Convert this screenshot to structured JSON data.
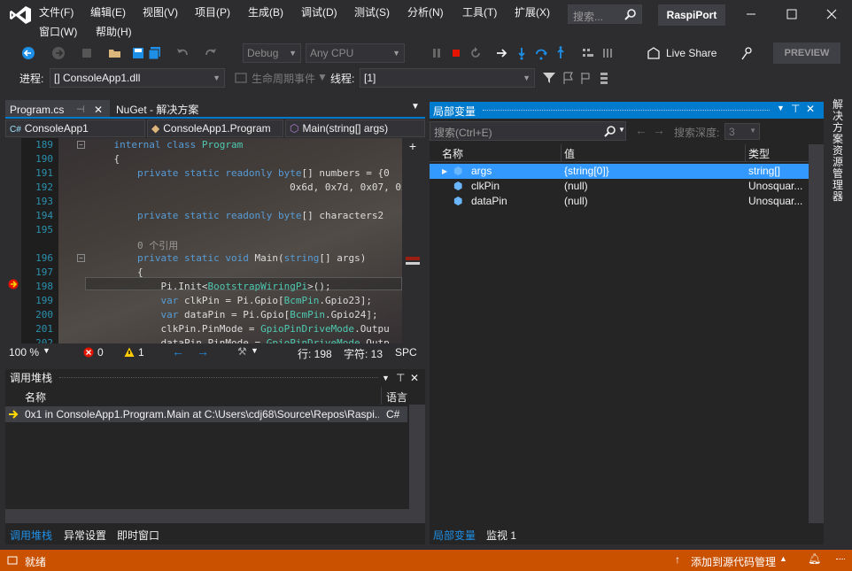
{
  "app": {
    "name": "RaspiPort"
  },
  "menu": [
    "文件(F)",
    "编辑(E)",
    "视图(V)",
    "项目(P)",
    "生成(B)",
    "调试(D)",
    "测试(S)",
    "分析(N)",
    "工具(T)",
    "扩展(X)",
    "窗口(W)",
    "帮助(H)"
  ],
  "search": {
    "placeholder": "搜索..."
  },
  "toolbar": {
    "config": "Debug",
    "platform": "Any CPU",
    "live_share": "Live Share",
    "preview": "PREVIEW"
  },
  "debugbar": {
    "process_label": "进程:",
    "process": "[] ConsoleApp1.dll",
    "lifecycle": "生命周期事件",
    "thread_label": "线程:",
    "thread": "[1]"
  },
  "editor": {
    "tabs": [
      "Program.cs",
      "NuGet - 解决方案"
    ],
    "nav": [
      "ConsoleApp1",
      "ConsoleApp1.Program",
      "Main(string[] args)"
    ],
    "lines": [
      {
        "n": "189",
        "t": "    internal class Program"
      },
      {
        "n": "190",
        "t": "    {"
      },
      {
        "n": "191",
        "t": "        private static readonly byte[] numbers = {0"
      },
      {
        "n": "192",
        "t": "                                  0x6d, 0x7d, 0x07, 0x7f,"
      },
      {
        "n": "193",
        "t": ""
      },
      {
        "n": "194",
        "t": "        private static readonly byte[] characters2"
      },
      {
        "n": "195",
        "t": ""
      },
      {
        "n": "",
        "t": "        0 个引用"
      },
      {
        "n": "196",
        "t": "        private static void Main(string[] args)"
      },
      {
        "n": "197",
        "t": "        {"
      },
      {
        "n": "198",
        "t": "            Pi.Init<BootstrapWiringPi>();"
      },
      {
        "n": "199",
        "t": "            var clkPin = Pi.Gpio[BcmPin.Gpio23];"
      },
      {
        "n": "200",
        "t": "            var dataPin = Pi.Gpio[BcmPin.Gpio24];"
      },
      {
        "n": "201",
        "t": "            clkPin.PinMode = GpioPinDriveMode.Outpu"
      },
      {
        "n": "202",
        "t": "            dataPin.PinMode = GpioPinDriveMode.Outp"
      }
    ],
    "status": {
      "zoom": "100 %",
      "errors": "0",
      "warnings": "1",
      "line": "行: 198",
      "char": "字符: 13",
      "mode": "SPC"
    }
  },
  "callstack": {
    "title": "调用堆栈",
    "col_name": "名称",
    "col_lang": "语言",
    "row_name": "0x1 in ConsoleApp1.Program.Main at C:\\Users\\cdj68\\Source\\Repos\\Raspi...",
    "row_lang": "C#",
    "tabs": [
      "调用堆栈",
      "异常设置",
      "即时窗口"
    ]
  },
  "locals": {
    "title": "局部变量",
    "search_placeholder": "搜索(Ctrl+E)",
    "depth_label": "搜索深度:",
    "depth": "3",
    "cols": [
      "名称",
      "值",
      "类型"
    ],
    "rows": [
      {
        "name": "args",
        "value": "{string[0]}",
        "type": "string[]"
      },
      {
        "name": "clkPin",
        "value": "(null)",
        "type": "Unosquar..."
      },
      {
        "name": "dataPin",
        "value": "(null)",
        "type": "Unosquar..."
      }
    ],
    "tabs": [
      "局部变量",
      "监视 1"
    ]
  },
  "rightdock": {
    "label": "解决方案资源管理器"
  },
  "statusbar": {
    "ready": "就绪",
    "source_control": "添加到源代码管理"
  },
  "colors": {
    "accent": "#007acc",
    "statusbar": "#ca5100"
  }
}
